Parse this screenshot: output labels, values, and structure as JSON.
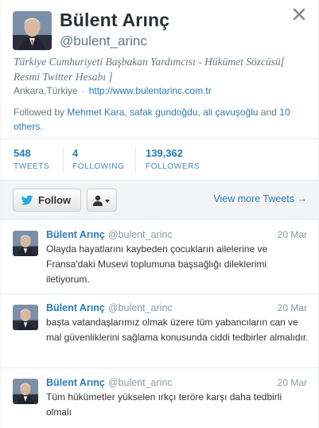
{
  "profile": {
    "full_name": "Bülent Arınç",
    "screen_name": "@bulent_arinc",
    "bio": "Türkiye Cumhuriyeti Başbakan Yardımcısı - Hükümet Sözcüsü[ Resmi Twitter Hesabı ]",
    "location": "Ankara,Türkiye",
    "separator": "·",
    "url": "http://www.bulentarinc.com.tr"
  },
  "followed_by": {
    "prefix": "Followed by",
    "names": [
      "Mehmet Kara",
      "safak gundoğdu",
      "ali çavuşoğlu"
    ],
    "comma1": ",",
    "comma2": ",",
    "and_text": "and",
    "others": "10 others",
    "period": "."
  },
  "stats": {
    "tweets": {
      "count": "548",
      "label": "TWEETS"
    },
    "following": {
      "count": "4",
      "label": "FOLLOWING"
    },
    "followers": {
      "count": "139,362",
      "label": "FOLLOWERS"
    }
  },
  "actions": {
    "follow_label": "Follow",
    "view_more": "View more Tweets →"
  },
  "tweets": [
    {
      "name": "Bülent Arınç",
      "handle": "@bulent_arinc",
      "date": "20 Mar",
      "text": "Olayda hayatlarını kaybeden çocukların ailelerine ve Fransa'daki Musevi toplumuna başsağlığı dileklerimi iletiyorum."
    },
    {
      "name": "Bülent Arınç",
      "handle": "@bulent_arinc",
      "date": "20 Mar",
      "text": "başta vatandaşlarımız olmak üzere tüm yabancıların can ve mal güvenliklerini sağlama konusunda ciddi tedbirler almalıdır."
    },
    {
      "name": "Bülent Arınç",
      "handle": "@bulent_arinc",
      "date": "20 Mar",
      "text": "Tüm hükümetler yükselen ırkçı teröre karşı daha tedbirli olmalı"
    }
  ],
  "colors": {
    "link": "#2a7ab8",
    "twitter_bird": "#2aa9e0",
    "muted": "#8899a6"
  },
  "icons": [
    "close-icon",
    "twitter-bird-icon",
    "user-icon",
    "caret-down-icon",
    "avatar"
  ]
}
